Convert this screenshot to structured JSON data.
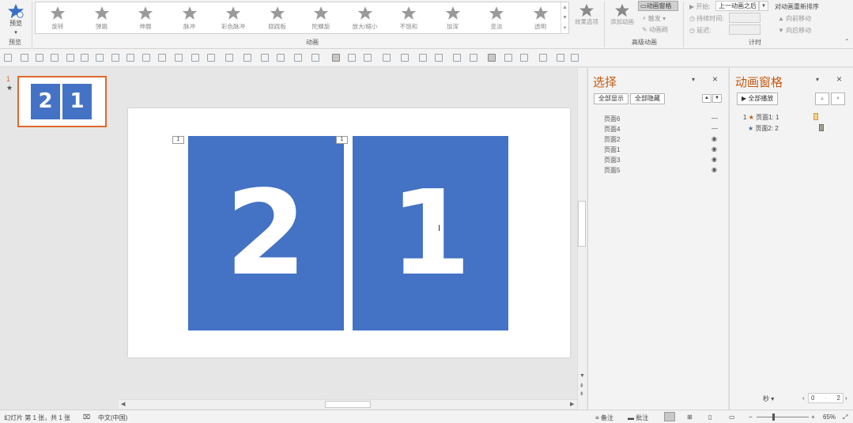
{
  "ribbon": {
    "preview": {
      "label": "预览",
      "group_label": "预览"
    },
    "animations": [
      "旋转",
      "弹跳",
      "伸展",
      "脉冲",
      "彩色脉冲",
      "跷跷板",
      "陀螺旋",
      "放大/缩小",
      "不饱和",
      "加深",
      "变淡",
      "透明"
    ],
    "animations_group_label": "动画",
    "effect_options_label": "效果选项",
    "add_animation_label": "添加动画",
    "animation_pane_label": "动画窗格",
    "trigger_label": "触发",
    "animation_painter_label": "动画刷",
    "advanced_group_label": "高级动画",
    "start_label": "开始:",
    "start_value": "上一动画之后",
    "duration_label": "持续时间:",
    "delay_label": "延迟:",
    "reorder_label": "对动画重新排序",
    "move_earlier_label": "向前移动",
    "move_later_label": "向后移动",
    "timing_group_label": "计时"
  },
  "thumbnail": {
    "number": "1",
    "marker": "★",
    "left_digit": "2",
    "right_digit": "1"
  },
  "slide": {
    "left_digit": "2",
    "right_digit": "1",
    "left_tag": "1",
    "right_tag": "1"
  },
  "selection_pane": {
    "title": "选择",
    "show_all": "全部显示",
    "hide_all": "全部隐藏",
    "items": [
      {
        "name": "页面6",
        "vis": "—"
      },
      {
        "name": "页面4",
        "vis": "—"
      },
      {
        "name": "页面2",
        "vis": "◉"
      },
      {
        "name": "页面1",
        "vis": "◉"
      },
      {
        "name": "页面3",
        "vis": "◉"
      },
      {
        "name": "页面5",
        "vis": "◉"
      }
    ]
  },
  "animation_pane": {
    "title": "动画窗格",
    "play_all": "全部播放",
    "items": [
      {
        "index": "1",
        "label": "页面1: 1"
      },
      {
        "index": "",
        "label": "页面2: 2"
      }
    ],
    "seconds_label": "秒",
    "timeline_start": "0",
    "timeline_end": "2"
  },
  "status": {
    "slide_info": "幻灯片 第 1 张，共 1 张",
    "language": "中文(中国)",
    "notes": "备注",
    "comments": "批注",
    "zoom": "65%"
  },
  "colors": {
    "accent": "#4472c4",
    "highlight": "#e0682f",
    "pane_title": "#c55a11"
  }
}
